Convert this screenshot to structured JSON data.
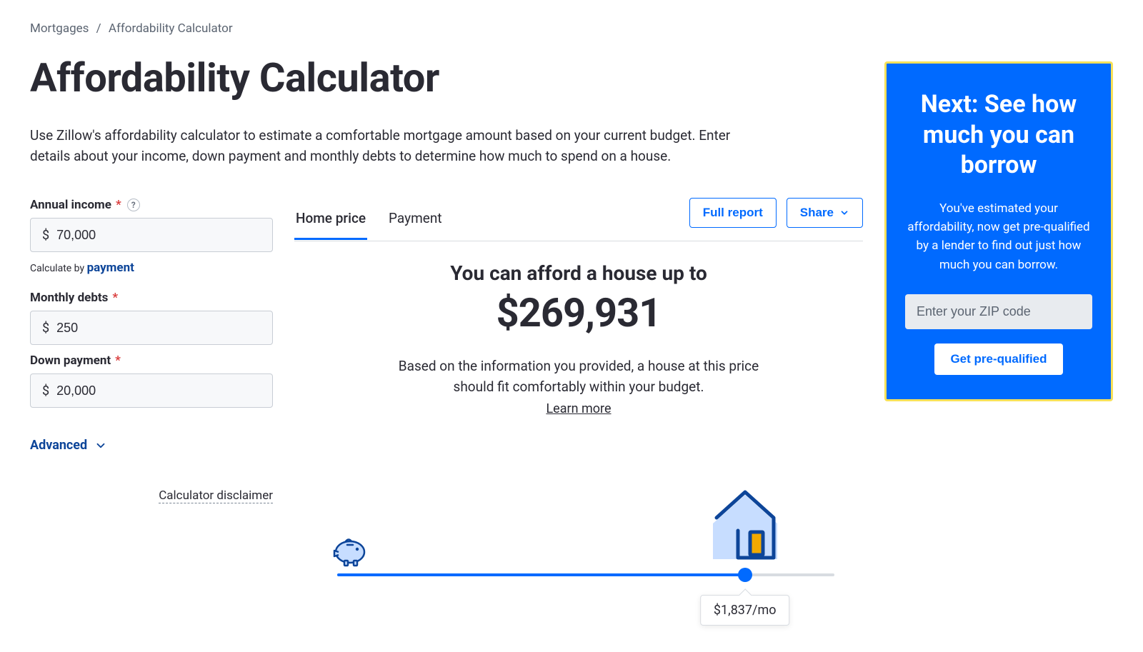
{
  "breadcrumb": {
    "parent": "Mortgages",
    "current": "Affordability Calculator"
  },
  "page": {
    "title": "Affordability Calculator",
    "description": "Use Zillow's affordability calculator to estimate a comfortable mortgage amount based on your current budget. Enter details about your income, down payment and monthly debts to determine how much to spend on a house."
  },
  "form": {
    "income_label": "Annual income",
    "income_value": "70,000",
    "calc_by_prefix": "Calculate by ",
    "calc_by_link": "payment",
    "debts_label": "Monthly debts",
    "debts_value": "250",
    "down_label": "Down payment",
    "down_value": "20,000",
    "advanced_label": "Advanced",
    "disclaimer": "Calculator disclaimer",
    "currency": "$",
    "required": "*"
  },
  "tabs": {
    "home_price": "Home price",
    "payment": "Payment",
    "full_report": "Full report",
    "share": "Share"
  },
  "result": {
    "headline": "You can afford a house up to",
    "amount": "$269,931",
    "description": "Based on the information you provided, a house at this price should fit comfortably within your budget.",
    "learn_more": "Learn more",
    "monthly_payment": "$1,837/mo"
  },
  "cta": {
    "title": "Next: See how much you can borrow",
    "description": "You've estimated your affordability, now get pre-qualified by a lender to find out just how much you can borrow.",
    "zip_placeholder": "Enter your ZIP code",
    "button": "Get pre-qualified"
  }
}
